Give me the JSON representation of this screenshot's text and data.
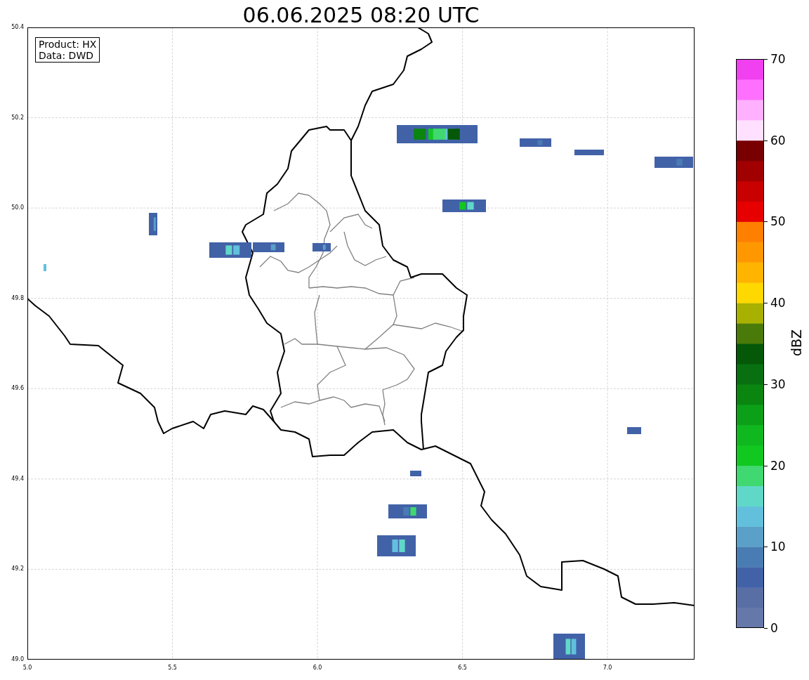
{
  "title": "06.06.2025 08:20 UTC",
  "info_box": [
    "Product: HX",
    "Data: DWD"
  ],
  "axes": {
    "yticks": [
      "50.4",
      "50.2",
      "50.0",
      "49.8",
      "49.6",
      "49.4",
      "49.2",
      "49.0"
    ],
    "xticks": [
      "5.0",
      "5.5",
      "6.0",
      "6.5",
      "7.0"
    ]
  },
  "colorbar": {
    "label": "dBZ",
    "ticks": [
      "70",
      "60",
      "50",
      "40",
      "30",
      "20",
      "10",
      "0"
    ],
    "bins": [
      {
        "color": "#6678aa"
      },
      {
        "color": "#5a6ea6"
      },
      {
        "color": "#4262a8"
      },
      {
        "color": "#4a7cb4"
      },
      {
        "color": "#5aa0c8"
      },
      {
        "color": "#62c0dc"
      },
      {
        "color": "#60d8c8"
      },
      {
        "color": "#40d870"
      },
      {
        "color": "#10c820"
      },
      {
        "color": "#10b820"
      },
      {
        "color": "#0ca018"
      },
      {
        "color": "#0a8510"
      },
      {
        "color": "#087010"
      },
      {
        "color": "#045808"
      },
      {
        "color": "#4a7a0a"
      },
      {
        "color": "#a8b000"
      },
      {
        "color": "#ffd800"
      },
      {
        "color": "#ffb400"
      },
      {
        "color": "#ff9800"
      },
      {
        "color": "#ff7f00"
      },
      {
        "color": "#e60000"
      },
      {
        "color": "#c80000"
      },
      {
        "color": "#a00000"
      },
      {
        "color": "#780000"
      },
      {
        "color": "#ffe0ff"
      },
      {
        "color": "#ffb0ff"
      },
      {
        "color": "#ff70ff"
      },
      {
        "color": "#f040f0"
      }
    ]
  }
}
